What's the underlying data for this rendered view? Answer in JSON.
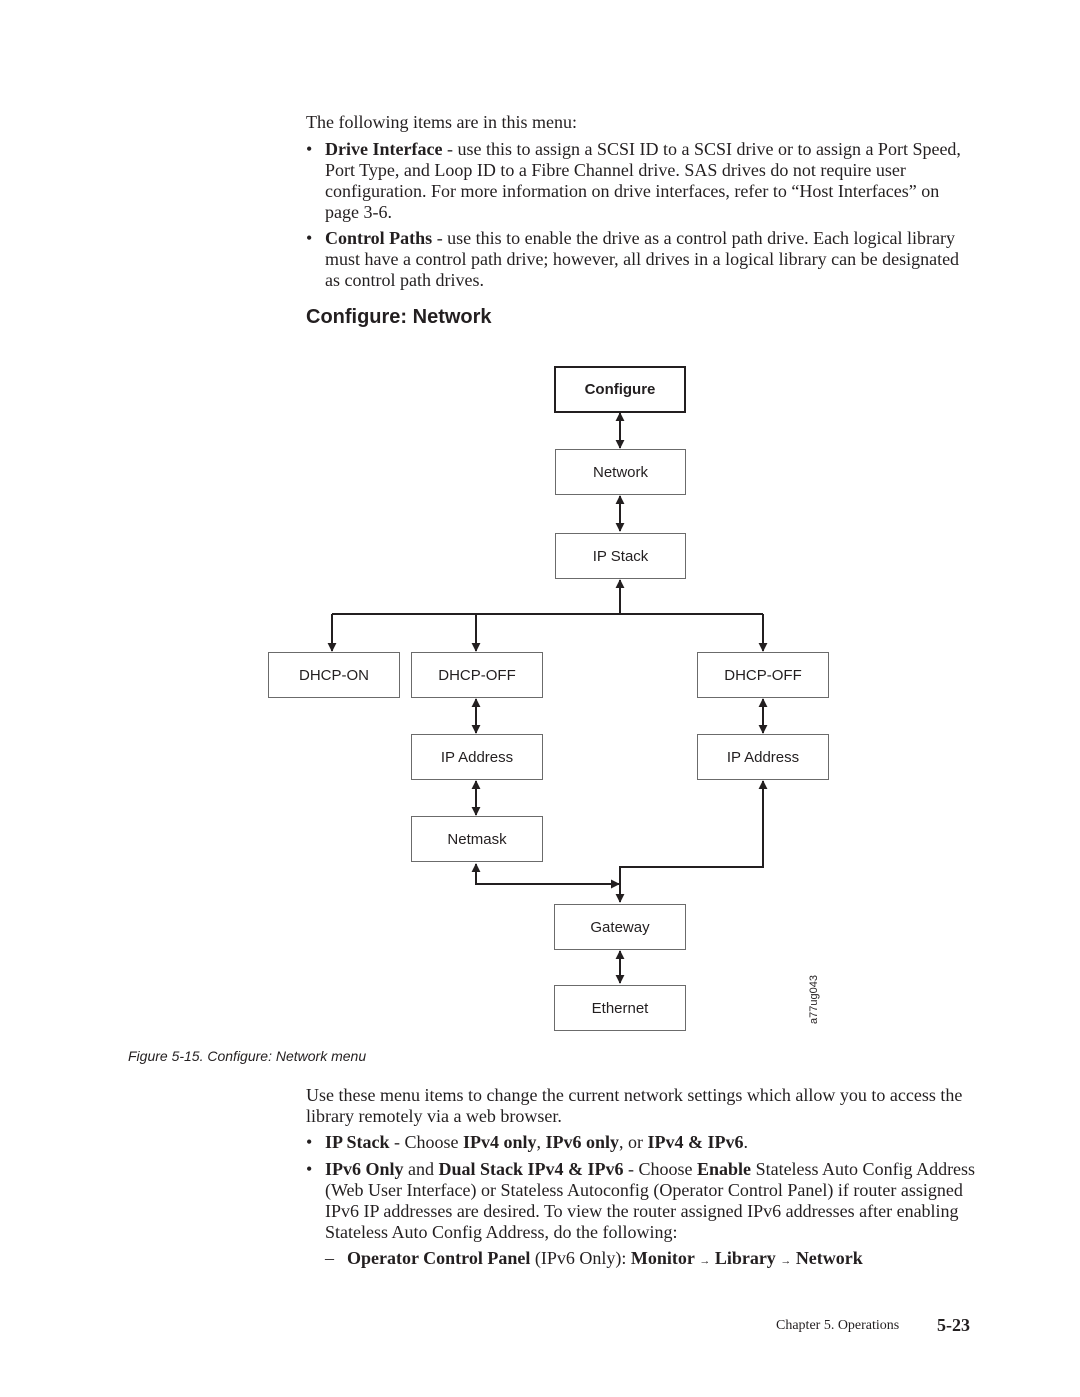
{
  "intro": "The following items are in this menu:",
  "menu_items": [
    {
      "term": "Drive Interface",
      "text": " - use this to assign a SCSI ID to a SCSI drive or to assign a Port Speed, Port Type, and Loop ID to a Fibre Channel drive. SAS drives do not require user configuration. For more information on drive interfaces, refer to “Host Interfaces” on page 3-6."
    },
    {
      "term": "Control Paths",
      "text": " - use this to enable the drive as a control path drive. Each logical library must have a control path drive; however, all drives in a logical library can be designated as control path drives."
    }
  ],
  "section_heading": "Configure: Network",
  "diagram": {
    "nodes": {
      "configure": "Configure",
      "network": "Network",
      "ip_stack": "IP Stack",
      "dhcp_on": "DHCP-ON",
      "dhcp_off_left": "DHCP-OFF",
      "dhcp_off_right": "DHCP-OFF",
      "ip_address_left": "IP Address",
      "ip_address_right": "IP Address",
      "netmask": "Netmask",
      "gateway": "Gateway",
      "ethernet": "Ethernet"
    },
    "figure_id": "a77ug043"
  },
  "caption": "Figure 5-15. Configure: Network menu",
  "usage_para": "Use these menu items to change the current network settings which allow you to access the library remotely via a web browser.",
  "ip_stack_bullet": {
    "term": "IP Stack",
    "sep": " - Choose ",
    "opt1": "IPv4 only",
    "comma1": ", ",
    "opt2": "IPv6 only",
    "or": ", or ",
    "opt3": "IPv4 & IPv6",
    "end": "."
  },
  "ipv6_bullet": {
    "term1": "IPv6 Only",
    "and": " and ",
    "term2": "Dual Stack IPv4 & IPv6",
    "sep": " - Choose ",
    "enable": "Enable",
    "rest": " Stateless Auto Config Address (Web User Interface) or Stateless Autoconfig (Operator Control Panel) if router assigned IPv6 IP addresses are desired. To view the router assigned IPv6 addresses after enabling Stateless Auto Config Address, do the following:"
  },
  "sub_item": {
    "term": "Operator Control Panel",
    "paren": " (IPv6 Only): ",
    "path": [
      "Monitor",
      "Library",
      "Network"
    ],
    "arrow": "→"
  },
  "footer": {
    "chapter": "Chapter 5. Operations",
    "page": "5-23"
  }
}
